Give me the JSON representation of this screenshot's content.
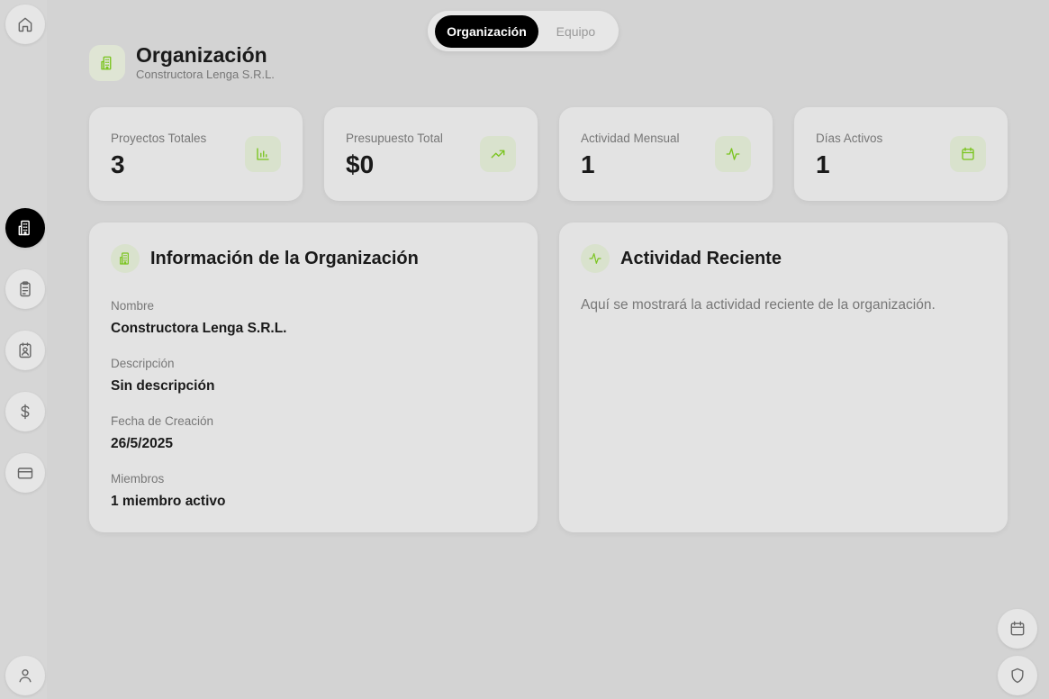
{
  "tabs": [
    {
      "label": "Organización",
      "active": true
    },
    {
      "label": "Equipo",
      "active": false
    }
  ],
  "header": {
    "title": "Organización",
    "subtitle": "Constructora Lenga S.R.L.",
    "icon": "building-icon"
  },
  "stats": [
    {
      "label": "Proyectos Totales",
      "value": "3",
      "icon": "bar-chart-icon"
    },
    {
      "label": "Presupuesto Total",
      "value": "$0",
      "icon": "trending-up-icon"
    },
    {
      "label": "Actividad Mensual",
      "value": "1",
      "icon": "activity-icon"
    },
    {
      "label": "Días Activos",
      "value": "1",
      "icon": "calendar-icon"
    }
  ],
  "info_panel": {
    "title": "Información de la Organización",
    "fields": [
      {
        "label": "Nombre",
        "value": "Constructora Lenga S.R.L."
      },
      {
        "label": "Descripción",
        "value": "Sin descripción"
      },
      {
        "label": "Fecha de Creación",
        "value": "26/5/2025"
      },
      {
        "label": "Miembros",
        "value": "1 miembro activo"
      }
    ]
  },
  "activity_panel": {
    "title": "Actividad Reciente",
    "empty_text": "Aquí se mostrará la actividad reciente de la organización."
  },
  "sidebar": {
    "items": [
      {
        "icon": "home-icon",
        "active": false
      },
      {
        "icon": "building-icon",
        "active": true
      },
      {
        "icon": "clipboard-icon",
        "active": false
      },
      {
        "icon": "contact-icon",
        "active": false
      },
      {
        "icon": "dollar-icon",
        "active": false
      },
      {
        "icon": "credit-card-icon",
        "active": false
      },
      {
        "icon": "user-icon",
        "active": false
      }
    ]
  },
  "floating": [
    {
      "icon": "calendar-icon"
    },
    {
      "icon": "shield-icon"
    }
  ],
  "colors": {
    "accent": "#7ac41e",
    "background": "#d3d3d3",
    "card": "#e3e3e3",
    "active": "#000000"
  }
}
